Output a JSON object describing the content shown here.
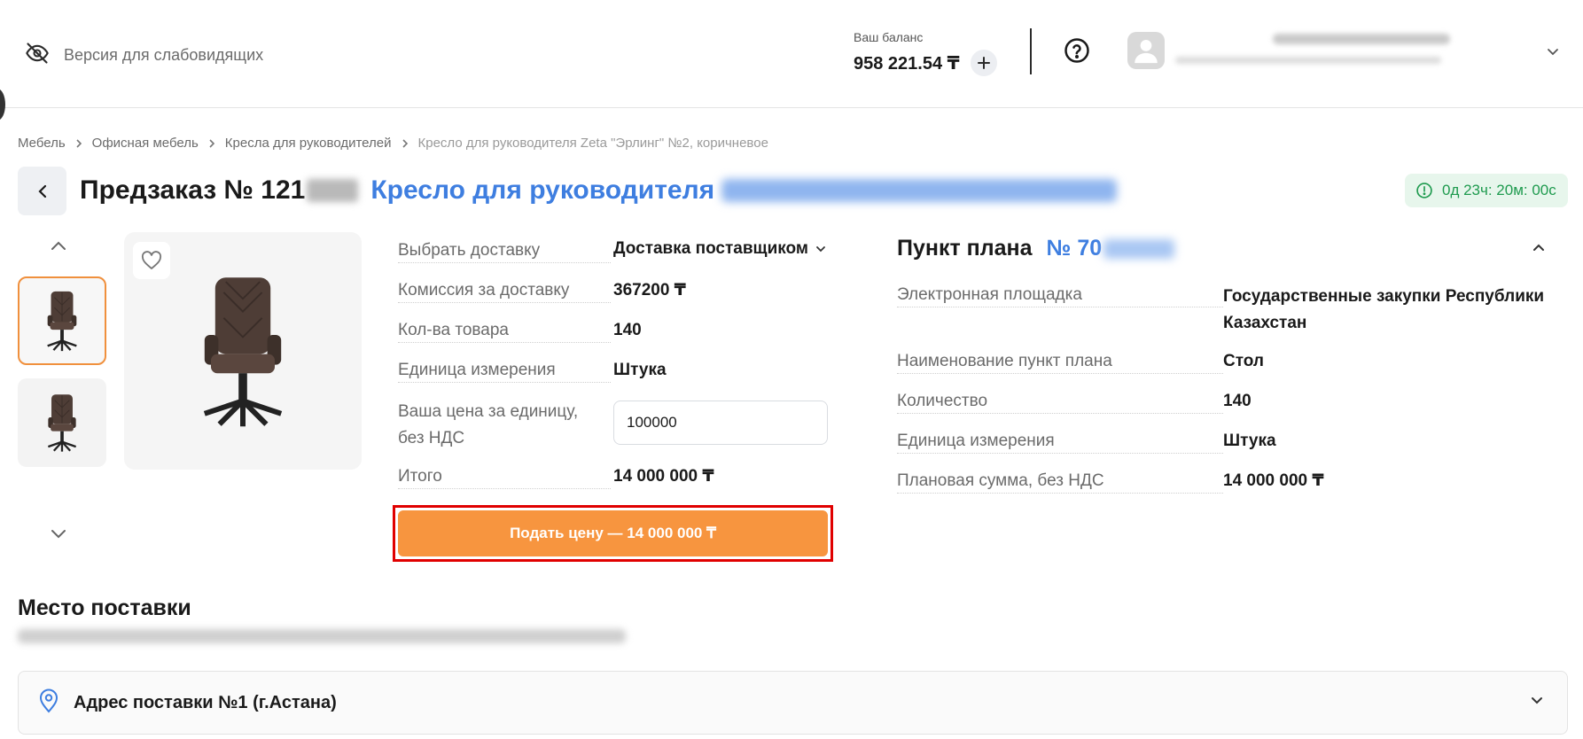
{
  "header": {
    "vision_label": "Версия для слабовидящих",
    "balance_caption": "Ваш баланс",
    "balance_value": "958 221.54 ₸"
  },
  "breadcrumb": [
    "Мебель",
    "Офисная мебель",
    "Кресла для руководителей",
    "Кресло для руководителя Zeta \"Эрлинг\" №2, коричневое"
  ],
  "title": {
    "prefix": "Предзаказ № 121",
    "link": "Кресло для руководителя"
  },
  "timer": "0д 23ч: 20м: 00с",
  "order": {
    "delivery_label": "Выбрать доставку",
    "delivery_value": "Доставка поставщиком",
    "commission_label": "Комиссия за доставку",
    "commission_value": "367200 ₸",
    "qty_label": "Кол-ва товара",
    "qty_value": "140",
    "unit_label": "Единица измерения",
    "unit_value": "Штука",
    "price_label_1": "Ваша цена за единицу,",
    "price_label_2": "без НДС",
    "price_value": "100000",
    "total_label": "Итого",
    "total_value": "14 000 000 ₸",
    "submit_label": "Подать цену — 14 000 000 ₸"
  },
  "plan": {
    "title": "Пункт плана",
    "number_prefix": "№ 70",
    "platform_label": "Электронная площадка",
    "platform_value_1": "Государственные закупки Республики",
    "platform_value_2": "Казахстан",
    "name_label": "Наименование пункт плана",
    "name_value": "Стол",
    "qty_label": "Количество",
    "qty_value": "140",
    "unit_label": "Единица измерения",
    "unit_value": "Штука",
    "sum_label": "Плановая сумма, без НДС",
    "sum_value": "14 000 000 ₸"
  },
  "delivery_place": {
    "title": "Место поставки",
    "address_label": "Адрес поставки №1 (г.Астана)"
  },
  "colors": {
    "accent_orange": "#f7953f",
    "link_blue": "#3e7ee0",
    "timer_green": "#1f9b4f",
    "highlight_red": "#e00000"
  }
}
